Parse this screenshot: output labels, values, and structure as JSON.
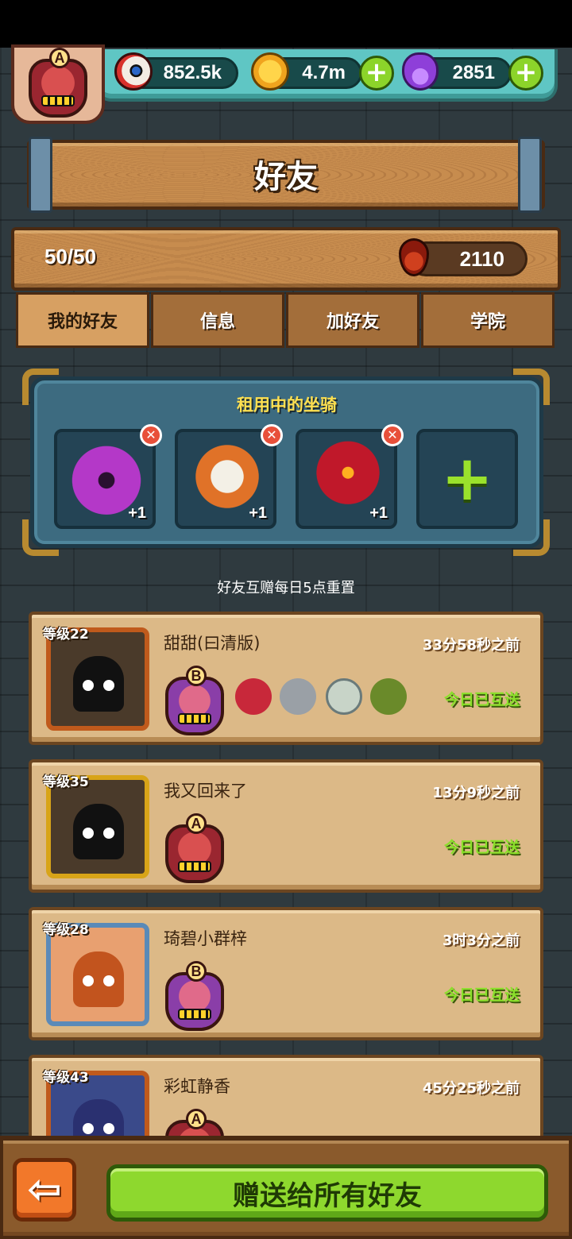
{
  "resources": {
    "eyes": "852.5k",
    "coins": "4.7m",
    "potions": "2851"
  },
  "player": {
    "rank": "A"
  },
  "header": {
    "title": "好友"
  },
  "summary": {
    "friend_count": "50/50",
    "blood": "2110"
  },
  "tabs": [
    {
      "label": "我的好友",
      "active": true
    },
    {
      "label": "信息"
    },
    {
      "label": "加好友"
    },
    {
      "label": "学院"
    }
  ],
  "mounts": {
    "title": "租用中的坐骑",
    "slots": [
      {
        "bonus": "+1",
        "icon": "purple-monster-mount"
      },
      {
        "bonus": "+1",
        "icon": "lion-dance-mount"
      },
      {
        "bonus": "+1",
        "icon": "rose-mount"
      }
    ]
  },
  "gift_note": "好友互赠每日5点重置",
  "friends": [
    {
      "level": "等级22",
      "name": "甜甜(曰清版)",
      "time": "33分58秒之前",
      "status": "今日已互送",
      "rank": "B"
    },
    {
      "level": "等级35",
      "name": "我又回来了",
      "time": "13分9秒之前",
      "status": "今日已互送",
      "rank": "A"
    },
    {
      "level": "等级28",
      "name": "琦碧小群梓",
      "time": "3时3分之前",
      "status": "今日已互送",
      "rank": "B"
    },
    {
      "level": "等级43",
      "name": "彩虹静香",
      "time": "45分25秒之前",
      "status": "",
      "rank": "A"
    }
  ],
  "footer": {
    "gift_all": "赠送给所有好友"
  },
  "colors": {
    "accent_green": "#8ed82e",
    "wood": "#c78c4e",
    "panel_blue": "#3d6b80"
  }
}
